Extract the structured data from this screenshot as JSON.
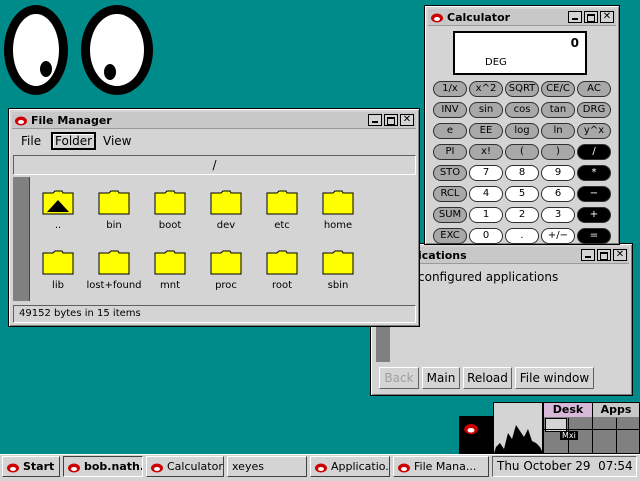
{
  "file_manager": {
    "title": "File Manager",
    "menu": [
      "File",
      "Folder",
      "View"
    ],
    "path": "/",
    "items": [
      "..",
      "bin",
      "boot",
      "dev",
      "etc",
      "home",
      "lib",
      "lost+found",
      "mnt",
      "proc",
      "root",
      "sbin"
    ],
    "status": "49152 bytes in 15 items"
  },
  "calculator": {
    "title": "Calculator",
    "display_value": "0",
    "display_mode": "DEG",
    "rows": [
      [
        "1/x",
        "x^2",
        "SQRT",
        "CE/C",
        "AC"
      ],
      [
        "INV",
        "sin",
        "cos",
        "tan",
        "DRG"
      ],
      [
        "e",
        "EE",
        "log",
        "ln",
        "y^x"
      ],
      [
        "PI",
        "x!",
        "(",
        ")",
        "/"
      ],
      [
        "STO",
        "7",
        "8",
        "9",
        "*"
      ],
      [
        "RCL",
        "4",
        "5",
        "6",
        "−"
      ],
      [
        "SUM",
        "1",
        "2",
        "3",
        "+"
      ],
      [
        "EXC",
        "0",
        ".",
        "+/−",
        "="
      ]
    ]
  },
  "applications": {
    "title_fragment": "ications",
    "body_fragment": "configured applications",
    "buttons": [
      "Back",
      "Main",
      "Reload",
      "File window"
    ]
  },
  "pager": {
    "desk_label": "Desk",
    "apps_label": "Apps",
    "mini_label": "Mxi"
  },
  "taskbar": {
    "start": "Start",
    "tasks": [
      "bob.nath...",
      "Calculator",
      "xeyes",
      "Applicatio...",
      "File Mana..."
    ],
    "clock": "Thu October 29  07:54"
  }
}
